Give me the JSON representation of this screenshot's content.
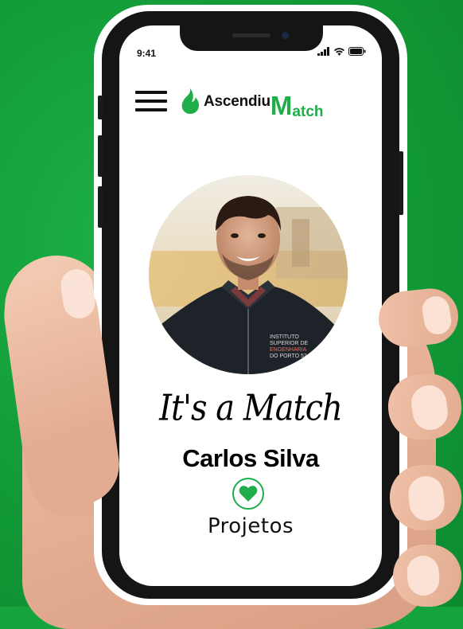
{
  "status_bar": {
    "time": "9:41",
    "signal_icon": "signal-bars-icon",
    "wifi_icon": "wifi-icon",
    "battery_icon": "battery-icon"
  },
  "header": {
    "menu_icon": "hamburger-menu-icon",
    "logo_icon": "flame-icon",
    "logo_part1": "Ascendiu",
    "logo_part2": "M",
    "logo_part3": "atch"
  },
  "profile": {
    "photo_alt": "Profile photo",
    "jacket_text": [
      "INSTITUTO",
      "SUPERIOR DE",
      "ENGENHARIA",
      "DO PORTO 52"
    ]
  },
  "match": {
    "title": "It's a Match",
    "name": "Carlos Silva",
    "heart_icon": "heart-icon",
    "category": "Projetos"
  },
  "colors": {
    "background": "#14a33c",
    "brand_green": "#1fae4a",
    "text": "#000000"
  }
}
